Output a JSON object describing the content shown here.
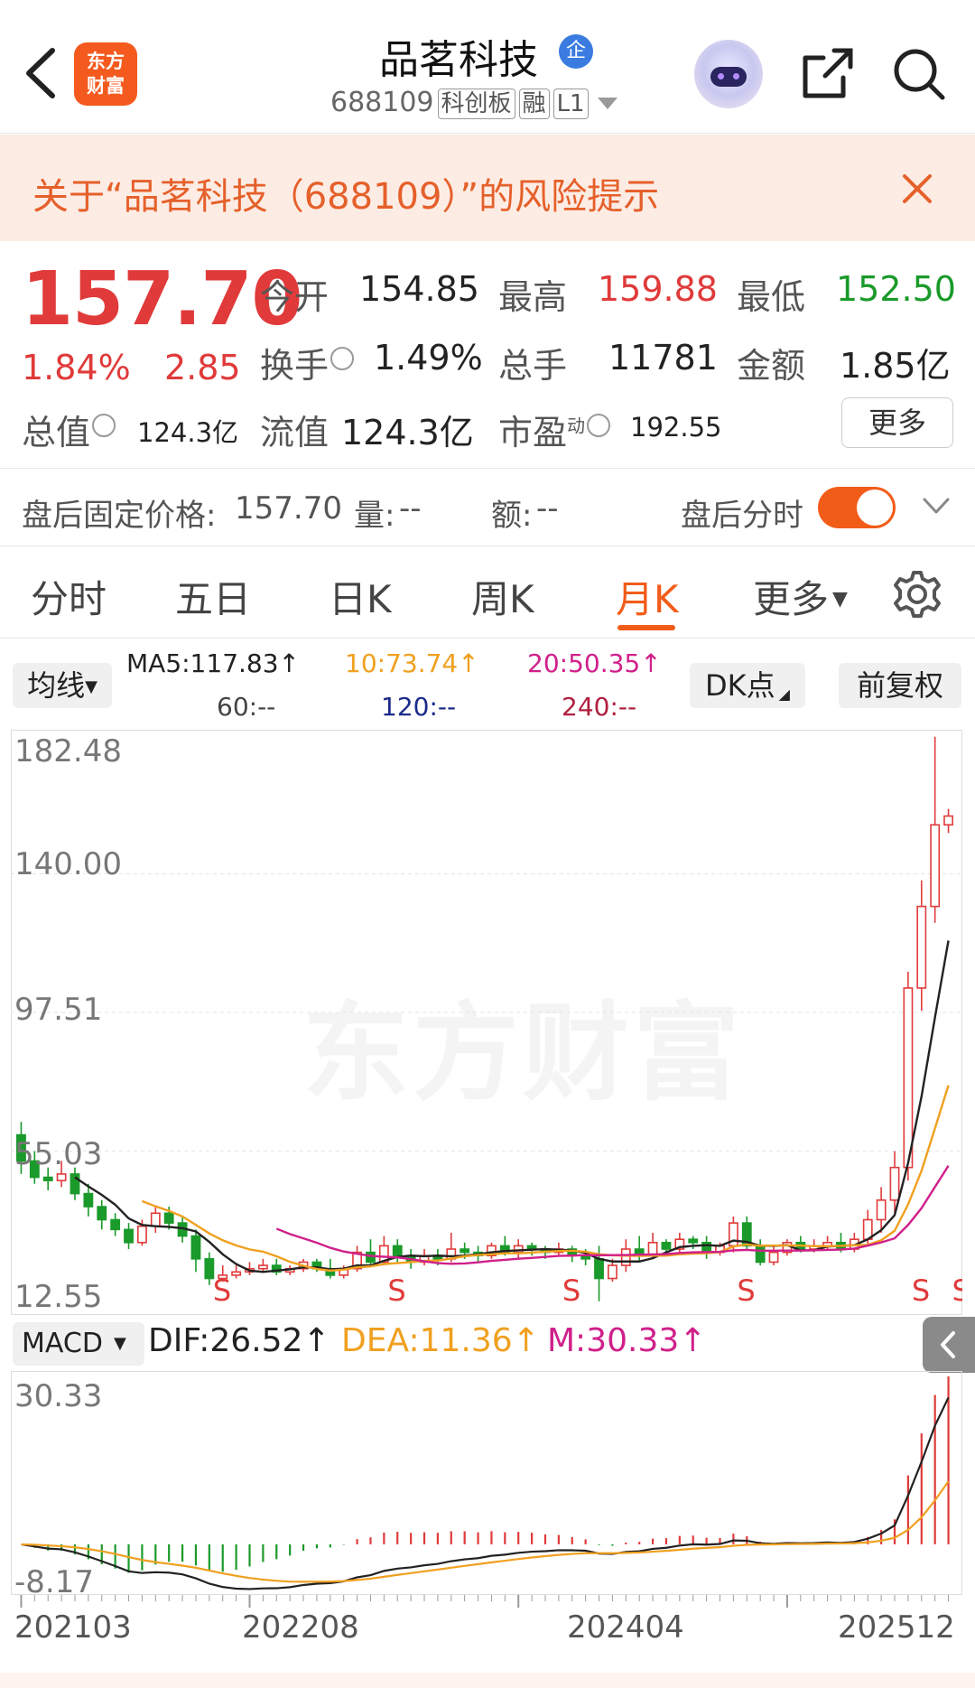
{
  "header": {
    "title": "品茗科技",
    "badge": "企",
    "code": "688109",
    "tags": [
      "科创板",
      "融",
      "L1"
    ],
    "logo_line1": "东方",
    "logo_line2": "财富"
  },
  "risk_banner": {
    "text": "关于“品茗科技（688109）”的风险提示"
  },
  "quote": {
    "price": "157.70",
    "change_pct": "1.84%",
    "change": "2.85",
    "open_label": "今开",
    "open": "154.85",
    "high_label": "最高",
    "high": "159.88",
    "low_label": "最低",
    "low": "152.50",
    "turnover_label": "换手",
    "turnover": "1.49%",
    "volume_label": "总手",
    "volume": "11781",
    "amount_label": "金额",
    "amount": "1.85亿",
    "mktcap_label": "总值",
    "mktcap": "124.3亿",
    "float_label": "流值",
    "float": "124.3亿",
    "pe_label": "市盈",
    "pe_sup": "动",
    "pe": "192.55",
    "more": "更多"
  },
  "after_hours": {
    "price_label": "盘后固定价格:",
    "price": "157.70",
    "vol_label": "量:",
    "vol": "--",
    "amt_label": "额:",
    "amt": "--",
    "toggle_label": "盘后分时",
    "toggle_on": true
  },
  "tabs": [
    "分时",
    "五日",
    "日K",
    "周K",
    "月K",
    "更多"
  ],
  "active_tab": "月K",
  "ma_legend": {
    "button": "均线",
    "ma5": "MA5:117.83↑",
    "ma10": "10:73.74↑",
    "ma20": "20:50.35↑",
    "ma60": "60:--",
    "ma120": "120:--",
    "ma240": "240:--",
    "dk": "DK点",
    "adjust": "前复权"
  },
  "kline_axis": [
    "182.48",
    "140.00",
    "97.51",
    "55.03",
    "12.55"
  ],
  "watermark": "东方财富",
  "signal_mark": "S",
  "macd": {
    "button": "MACD",
    "dif": "DIF:26.52↑",
    "dea": "DEA:11.36↑",
    "m": "M:30.33↑",
    "top": "30.33",
    "bottom": "-8.17"
  },
  "x_axis": [
    "202103",
    "202208",
    "202404",
    "202512"
  ],
  "colors": {
    "up": "#e03a3a",
    "down": "#1a9a2a",
    "accent": "#f25c19",
    "ma5": "#222222",
    "ma10": "#f0a020",
    "ma20": "#d0208a",
    "ma120": "#1a2a8a",
    "ma240": "#b02040"
  },
  "chart_data": {
    "type": "candlestick",
    "period": "monthly",
    "y_range": [
      12.55,
      182.48
    ],
    "x_ticks": [
      "202103",
      "202208",
      "202404",
      "202512"
    ],
    "candles": [
      [
        60,
        52,
        64,
        48
      ],
      [
        52,
        47,
        55,
        45
      ],
      [
        47,
        46,
        50,
        43
      ],
      [
        46,
        48,
        52,
        44
      ],
      [
        48,
        42,
        50,
        40
      ],
      [
        42,
        38,
        45,
        35
      ],
      [
        38,
        34,
        40,
        31
      ],
      [
        34,
        31,
        36,
        29
      ],
      [
        31,
        27,
        33,
        25
      ],
      [
        27,
        32,
        34,
        26
      ],
      [
        32,
        36,
        38,
        30
      ],
      [
        36,
        33,
        38,
        31
      ],
      [
        33,
        29,
        35,
        27
      ],
      [
        29,
        22,
        31,
        18
      ],
      [
        22,
        16,
        24,
        14
      ],
      [
        16,
        17,
        20,
        15
      ],
      [
        17,
        18,
        20,
        16
      ],
      [
        18,
        19,
        21,
        17
      ],
      [
        19,
        20,
        22,
        18
      ],
      [
        20,
        18,
        22,
        17
      ],
      [
        18,
        19,
        20,
        17
      ],
      [
        19,
        21,
        22,
        18
      ],
      [
        21,
        19,
        22,
        18
      ],
      [
        19,
        17,
        22,
        16
      ],
      [
        17,
        19,
        20,
        16
      ],
      [
        19,
        24,
        26,
        18
      ],
      [
        24,
        21,
        28,
        20
      ],
      [
        21,
        26,
        29,
        20
      ],
      [
        26,
        23,
        28,
        21
      ],
      [
        23,
        21,
        25,
        19
      ],
      [
        21,
        23,
        25,
        20
      ],
      [
        23,
        22,
        25,
        20
      ],
      [
        22,
        25,
        30,
        21
      ],
      [
        25,
        24,
        27,
        22
      ],
      [
        24,
        23,
        26,
        21
      ],
      [
        23,
        26,
        27,
        22
      ],
      [
        26,
        24,
        29,
        23
      ],
      [
        24,
        26,
        28,
        22
      ],
      [
        26,
        25,
        27,
        23
      ],
      [
        25,
        24,
        26,
        22
      ],
      [
        24,
        25,
        27,
        23
      ],
      [
        25,
        23,
        26,
        21
      ],
      [
        23,
        22,
        25,
        20
      ],
      [
        22,
        16,
        26,
        9
      ],
      [
        16,
        20,
        22,
        15
      ],
      [
        20,
        25,
        28,
        18
      ],
      [
        25,
        23,
        29,
        21
      ],
      [
        23,
        27,
        30,
        22
      ],
      [
        27,
        25,
        28,
        23
      ],
      [
        25,
        28,
        30,
        24
      ],
      [
        28,
        27,
        29,
        25
      ],
      [
        27,
        24,
        29,
        22
      ],
      [
        24,
        26,
        27,
        23
      ],
      [
        26,
        33,
        35,
        24
      ],
      [
        33,
        26,
        35,
        25
      ],
      [
        26,
        21,
        28,
        20
      ],
      [
        21,
        24,
        26,
        20
      ],
      [
        24,
        27,
        28,
        23
      ],
      [
        27,
        25,
        29,
        24
      ],
      [
        25,
        26,
        28,
        24
      ],
      [
        26,
        27,
        29,
        25
      ],
      [
        27,
        25,
        30,
        24
      ],
      [
        25,
        28,
        30,
        24
      ],
      [
        28,
        34,
        37,
        26
      ],
      [
        34,
        40,
        44,
        30
      ],
      [
        40,
        50,
        55,
        36
      ],
      [
        50,
        105,
        110,
        46
      ],
      [
        105,
        130,
        138,
        98
      ],
      [
        130,
        155,
        182,
        125
      ],
      [
        155,
        157.7,
        159.88,
        152.5
      ]
    ],
    "macd_range": [
      -8.17,
      30.33
    ],
    "dif_last": 26.52,
    "dea_last": 11.36,
    "m_last": 30.33,
    "ma5_last": 117.83,
    "ma10_last": 73.74,
    "ma20_last": 50.35
  }
}
